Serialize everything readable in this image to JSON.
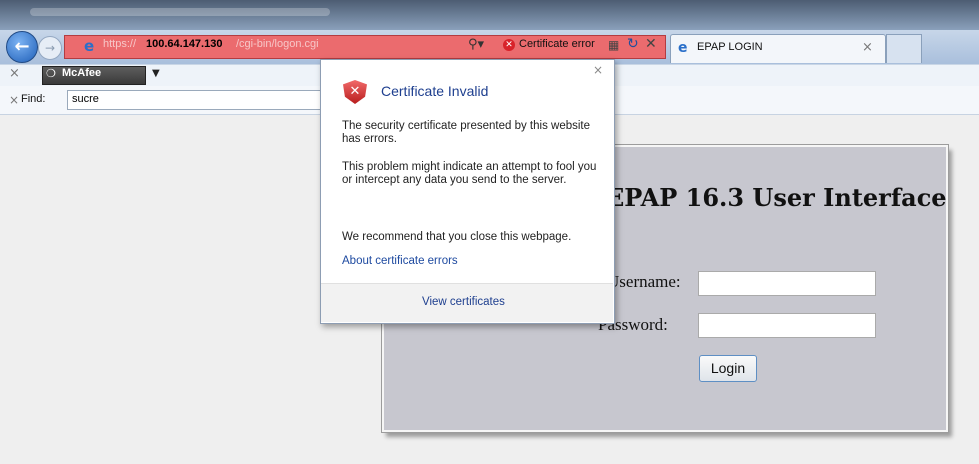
{
  "browser": {
    "address": {
      "scheme": "https://",
      "host": "100.64.147.130",
      "path": "/cgi-bin/logon.cgi"
    },
    "certificate_error_label": "Certificate error",
    "tab_title": "EPAP LOGIN",
    "toolbar": {
      "mcafee_label": "McAfee"
    },
    "find": {
      "label": "Find:",
      "value": "sucre"
    }
  },
  "page": {
    "title": "EPAP 16.3 User Interface",
    "username_label": "Username:",
    "password_label": "Password:",
    "login_button": "Login"
  },
  "popup": {
    "title": "Certificate Invalid",
    "paragraph1": "The security certificate presented by this website has errors.",
    "paragraph2": "This problem might indicate an attempt to fool you or intercept any data you send to the server.",
    "paragraph3": "We recommend that you close this webpage.",
    "link_about": "About certificate errors",
    "link_view": "View certificates"
  },
  "colors": {
    "address_error_bg": "#eb6b6e",
    "page_box_bg": "#c7c7cf",
    "popup_title": "#1e3f8f"
  }
}
